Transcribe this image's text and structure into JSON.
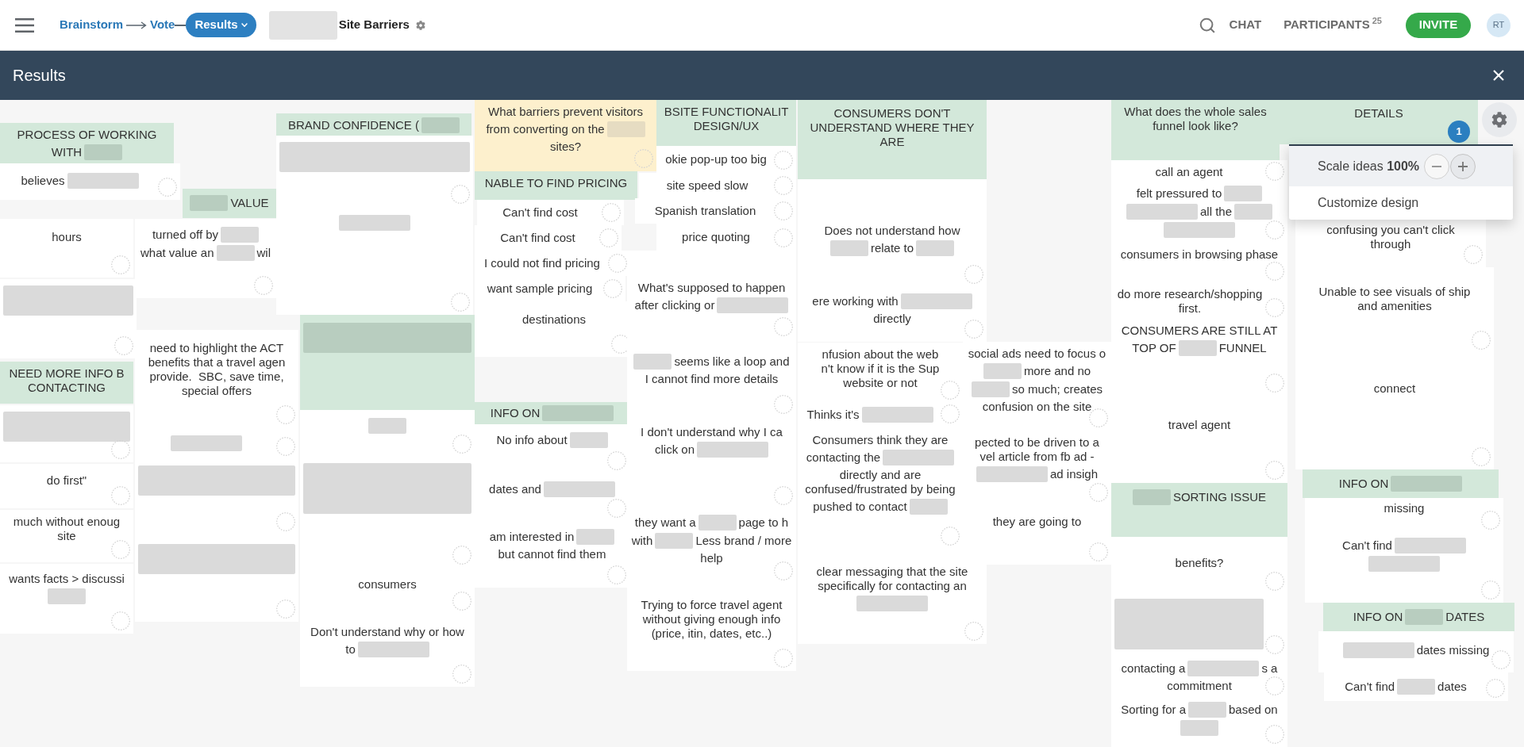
{
  "top_bar": {
    "steps": [
      {
        "label": "Brainstorm",
        "selected": false
      },
      {
        "label": "Vote",
        "selected": false
      },
      {
        "label": "Results",
        "selected": true
      }
    ],
    "session": {
      "redacted_prefix": true,
      "title": "Site Barriers"
    },
    "actions": {
      "chat": "CHAT",
      "participants": "PARTICIPANTS",
      "participant_count": "25",
      "invite": "INVITE"
    },
    "avatar": "RT"
  },
  "results_bar": {
    "title": "Results"
  },
  "settings_menu": {
    "scale_label": "Scale ideas **100%**",
    "items": [
      "Customize design"
    ]
  },
  "cards": [
    {
      "kind": "header",
      "lines": [
        [
          "PROCESS OF WORKING"
        ],
        [
          "WITH",
          {
            "kind": "redacted"
          }
        ]
      ]
    },
    {
      "kind": "idea",
      "lines": [
        [
          "believes",
          {
            "kind": "redacted_wide"
          }
        ]
      ]
    },
    {
      "kind": "idea",
      "lines": [
        [
          "hours"
        ]
      ]
    },
    {
      "kind": "idea",
      "lines": [
        [
          {
            "kind": "redacted_block"
          }
        ]
      ]
    },
    {
      "kind": "header",
      "lines": [
        [
          "NEED MORE INFO B\nCONTACTING"
        ]
      ]
    },
    {
      "kind": "idea",
      "lines": [
        [
          {
            "kind": "redacted_block"
          }
        ]
      ]
    },
    {
      "kind": "idea",
      "lines": [
        [
          "do first\""
        ]
      ]
    },
    {
      "kind": "idea",
      "lines": [
        [
          "much without enoug\nsite"
        ]
      ]
    },
    {
      "kind": "idea",
      "lines": [
        [
          "wants facts > discussi"
        ],
        [
          {
            "kind": "redacted"
          }
        ]
      ]
    },
    {
      "kind": "header",
      "lines": [
        [
          {
            "kind": "redacted"
          },
          "VALUE"
        ]
      ]
    },
    {
      "kind": "idea",
      "lines": [
        [
          "turned off by",
          {
            "kind": "redacted"
          }
        ],
        [
          "what value an",
          {
            "kind": "redacted"
          },
          "wil"
        ]
      ]
    },
    {
      "kind": "idea",
      "lines": [
        [
          "need to highlight the ACT\nbenefits that a travel agen\nprovide.  SBC, save time,\nspecial offers"
        ]
      ]
    },
    {
      "kind": "idea",
      "lines": [
        [
          {
            "kind": "redacted_wide"
          }
        ]
      ]
    },
    {
      "kind": "idea",
      "lines": [
        [
          {
            "kind": "redacted_block"
          }
        ]
      ]
    },
    {
      "kind": "idea",
      "lines": [
        [
          {
            "kind": "redacted_block"
          }
        ]
      ]
    },
    {
      "kind": "header",
      "lines": [
        [
          "BRAND CONFIDENCE (",
          {
            "kind": "redacted"
          }
        ]
      ]
    },
    {
      "kind": "idea",
      "lines": [
        [
          {
            "kind": "redacted_block"
          }
        ]
      ]
    },
    {
      "kind": "idea",
      "lines": [
        [
          {
            "kind": "redacted_wide"
          }
        ]
      ]
    },
    {
      "kind": "header",
      "lines": [
        [
          {
            "kind": "redacted_block"
          }
        ]
      ]
    },
    {
      "kind": "idea",
      "lines": [
        [
          {
            "kind": "redacted"
          }
        ]
      ]
    },
    {
      "kind": "idea",
      "lines": [
        [
          {
            "kind": "redacted_tall"
          }
        ]
      ]
    },
    {
      "kind": "idea",
      "lines": [
        [
          "consumers"
        ]
      ]
    },
    {
      "kind": "idea",
      "lines": [
        [
          "Don't understand why or how"
        ],
        [
          "to",
          {
            "kind": "redacted_wide"
          }
        ]
      ]
    },
    {
      "kind": "question",
      "lines": [
        [
          "What barriers prevent visitors"
        ],
        [
          "from converting on the",
          {
            "kind": "redacted"
          }
        ],
        [
          "sites?"
        ]
      ]
    },
    {
      "kind": "header",
      "lines": [
        [
          "NABLE TO FIND PRICING"
        ]
      ]
    },
    {
      "kind": "idea",
      "lines": [
        [
          "Can't find cost"
        ]
      ]
    },
    {
      "kind": "idea",
      "lines": [
        [
          "Can't find cost"
        ]
      ]
    },
    {
      "kind": "idea",
      "lines": [
        [
          "I could not find pricing"
        ]
      ]
    },
    {
      "kind": "idea",
      "lines": [
        [
          "want sample pricing"
        ]
      ]
    },
    {
      "kind": "idea",
      "lines": [
        [
          "destinations"
        ]
      ]
    },
    {
      "kind": "header",
      "lines": [
        [
          "INFO ON",
          {
            "kind": "redacted_wide"
          }
        ]
      ]
    },
    {
      "kind": "idea",
      "lines": [
        [
          "No info about",
          {
            "kind": "redacted"
          }
        ]
      ]
    },
    {
      "kind": "idea",
      "lines": [
        [
          "dates and",
          {
            "kind": "redacted_wide"
          }
        ]
      ]
    },
    {
      "kind": "idea",
      "lines": [
        [
          "am interested in",
          {
            "kind": "redacted"
          }
        ],
        [
          "but cannot find them"
        ]
      ]
    },
    {
      "kind": "header",
      "lines": [
        [
          "BSITE FUNCTIONALIT\nDESIGN/UX"
        ]
      ]
    },
    {
      "kind": "idea",
      "lines": [
        [
          "okie pop-up too big"
        ]
      ]
    },
    {
      "kind": "idea",
      "lines": [
        [
          "site speed slow"
        ]
      ]
    },
    {
      "kind": "idea",
      "lines": [
        [
          "Spanish translation"
        ]
      ]
    },
    {
      "kind": "idea",
      "lines": [
        [
          "price quoting"
        ]
      ]
    },
    {
      "kind": "idea",
      "lines": [
        [
          "What's supposed to happen"
        ],
        [
          "after clicking or",
          {
            "kind": "redacted_wide"
          }
        ]
      ]
    },
    {
      "kind": "idea",
      "lines": [
        [
          {
            "kind": "redacted"
          },
          "seems like a loop and"
        ],
        [
          "I cannot find more details"
        ]
      ]
    },
    {
      "kind": "idea",
      "lines": [
        [
          "I don't understand why I ca"
        ],
        [
          "click on",
          {
            "kind": "redacted_wide"
          }
        ]
      ]
    },
    {
      "kind": "idea",
      "lines": [
        [
          "they want a",
          {
            "kind": "redacted"
          },
          "page to h"
        ],
        [
          "with",
          {
            "kind": "redacted"
          },
          "Less brand / more"
        ],
        [
          "help"
        ]
      ]
    },
    {
      "kind": "idea",
      "lines": [
        [
          "Trying to force travel agent\nwithout giving enough info\n(price, itin, dates, etc..)"
        ]
      ]
    },
    {
      "kind": "header",
      "lines": [
        [
          "CONSUMERS DON'T\nUNDERSTAND WHERE THEY\nARE"
        ]
      ]
    },
    {
      "kind": "idea",
      "lines": [
        [
          "Does not understand how"
        ],
        [
          {
            "kind": "redacted"
          },
          "relate to",
          {
            "kind": "redacted"
          }
        ]
      ]
    },
    {
      "kind": "idea",
      "lines": [
        [
          "ere working with",
          {
            "kind": "redacted_wide"
          }
        ],
        [
          "directly"
        ]
      ]
    },
    {
      "kind": "idea",
      "lines": [
        [
          "nfusion about the web\nn't know if it is the Sup\nwebsite or not"
        ]
      ]
    },
    {
      "kind": "idea",
      "lines": [
        [
          "Thinks it's",
          {
            "kind": "redacted_wide"
          }
        ]
      ]
    },
    {
      "kind": "idea",
      "lines": [
        [
          "Consumers think they are"
        ],
        [
          "contacting the",
          {
            "kind": "redacted_wide"
          }
        ],
        [
          "directly and are\nconfused/frustrated by being"
        ],
        [
          "pushed to contact",
          {
            "kind": "redacted"
          }
        ]
      ]
    },
    {
      "kind": "idea",
      "lines": [
        [
          "clear messaging that the site\nspecifically for contacting an"
        ],
        [
          {
            "kind": "redacted_wide"
          }
        ]
      ]
    },
    {
      "kind": "idea",
      "lines": [
        [
          "social ads need to focus o"
        ],
        [
          {
            "kind": "redacted"
          },
          "more and no"
        ],
        [
          {
            "kind": "redacted"
          },
          "so much; creates"
        ],
        [
          "confusion on the site"
        ]
      ]
    },
    {
      "kind": "idea",
      "lines": [
        [
          "pected to be driven to a\nvel article from fb ad -"
        ],
        [
          {
            "kind": "redacted_wide"
          },
          "ad insigh"
        ]
      ]
    },
    {
      "kind": "idea",
      "lines": [
        [
          "they are going to"
        ]
      ]
    },
    {
      "kind": "header",
      "lines": [
        [
          "What does the whole sales\nfunnel look like?"
        ]
      ]
    },
    {
      "kind": "idea",
      "lines": [
        [
          "call an agent"
        ]
      ]
    },
    {
      "kind": "idea",
      "lines": [
        [
          "felt pressured to",
          {
            "kind": "redacted"
          }
        ],
        [
          {
            "kind": "redacted_wide"
          },
          "all the",
          {
            "kind": "redacted"
          }
        ],
        [
          {
            "kind": "redacted_wide"
          }
        ]
      ]
    },
    {
      "kind": "idea",
      "lines": [
        [
          "consumers in browsing phase"
        ]
      ]
    },
    {
      "kind": "idea",
      "lines": [
        [
          "do more research/shopping\nfirst."
        ]
      ]
    },
    {
      "kind": "idea",
      "lines": [
        [
          "CONSUMERS ARE STILL AT"
        ],
        [
          "TOP OF",
          {
            "kind": "redacted"
          },
          "FUNNEL"
        ]
      ]
    },
    {
      "kind": "idea",
      "lines": [
        [
          "travel agent"
        ]
      ]
    },
    {
      "kind": "header",
      "lines": [
        [
          {
            "kind": "redacted"
          },
          "SORTING ISSUE"
        ]
      ]
    },
    {
      "kind": "idea",
      "lines": [
        [
          "benefits?"
        ]
      ]
    },
    {
      "kind": "idea",
      "lines": [
        [
          {
            "kind": "redacted_tall"
          }
        ]
      ]
    },
    {
      "kind": "idea",
      "lines": [
        [
          "contacting a",
          {
            "kind": "redacted_wide"
          },
          "s a"
        ],
        [
          "commitment"
        ]
      ]
    },
    {
      "kind": "idea",
      "lines": [
        [
          "Sorting for a",
          {
            "kind": "redacted"
          },
          "based on"
        ],
        [
          {
            "kind": "redacted"
          }
        ]
      ]
    },
    {
      "kind": "header",
      "lines": [
        [
          "DETAILS"
        ]
      ],
      "badge": "1"
    },
    {
      "kind": "idea",
      "lines": [
        [
          "confusing you can't click\nthrough"
        ]
      ]
    },
    {
      "kind": "idea",
      "lines": [
        [
          "Unable to see visuals of ship\nand amenities"
        ]
      ]
    },
    {
      "kind": "idea",
      "lines": [
        [
          "connect"
        ]
      ]
    },
    {
      "kind": "header",
      "lines": [
        [
          "INFO ON",
          {
            "kind": "redacted_wide"
          }
        ]
      ]
    },
    {
      "kind": "idea",
      "lines": [
        [
          "missing"
        ]
      ]
    },
    {
      "kind": "idea",
      "lines": [
        [
          "Can't find",
          {
            "kind": "redacted_wide"
          }
        ],
        [
          {
            "kind": "redacted_wide"
          }
        ]
      ]
    },
    {
      "kind": "header",
      "lines": [
        [
          "INFO ON",
          {
            "kind": "redacted"
          },
          "DATES"
        ]
      ]
    },
    {
      "kind": "idea",
      "lines": [
        [
          {
            "kind": "redacted_wide"
          },
          "dates missing"
        ]
      ]
    },
    {
      "kind": "idea",
      "lines": [
        [
          "Can't find",
          {
            "kind": "redacted"
          },
          "dates"
        ]
      ]
    }
  ]
}
